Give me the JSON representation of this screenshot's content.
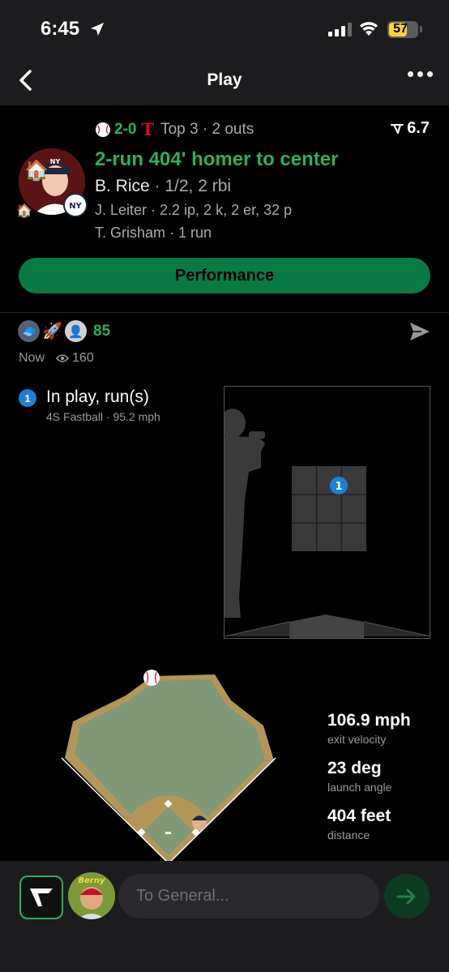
{
  "status_bar": {
    "time": "6:45",
    "battery": "57"
  },
  "nav": {
    "title": "Play"
  },
  "game": {
    "score": "2-0",
    "inning_state": "Top 3 · 2 outs",
    "win_prob": "6.7"
  },
  "play": {
    "headline": "2-run 404' homer to center",
    "batter_name": "B. Rice",
    "batter_stats": " · 1/2, 2 rbi",
    "pitcher_line": "J. Leiter · 2.2 ip, 2 k, 2 er, 32 p",
    "runner_line": "T. Grisham · 1 run"
  },
  "performance_button": "Performance",
  "social": {
    "reaction_count": "85",
    "posted": "Now",
    "views": "160"
  },
  "pitch": {
    "number": "1",
    "result": "In play, run(s)",
    "detail": "4S Fastball ·  95.2 mph"
  },
  "batted_ball": {
    "exit_velocity": "106.9 mph",
    "exit_velocity_label": "exit velocity",
    "launch_angle": "23 deg",
    "launch_angle_label": "launch angle",
    "distance": "404 feet",
    "distance_label": "distance"
  },
  "sticker_text": "Berny",
  "composer": {
    "placeholder": "To General..."
  },
  "colors": {
    "accent_green": "#2fae5f",
    "button_green": "#0a7a45",
    "pitch_blue": "#1e7fd6"
  },
  "icons": [
    "location-arrow-icon",
    "back-chevron-icon",
    "more-icon",
    "win-prob-icon",
    "send-icon",
    "eye-icon",
    "app-logo-icon",
    "send-arrow-icon"
  ]
}
